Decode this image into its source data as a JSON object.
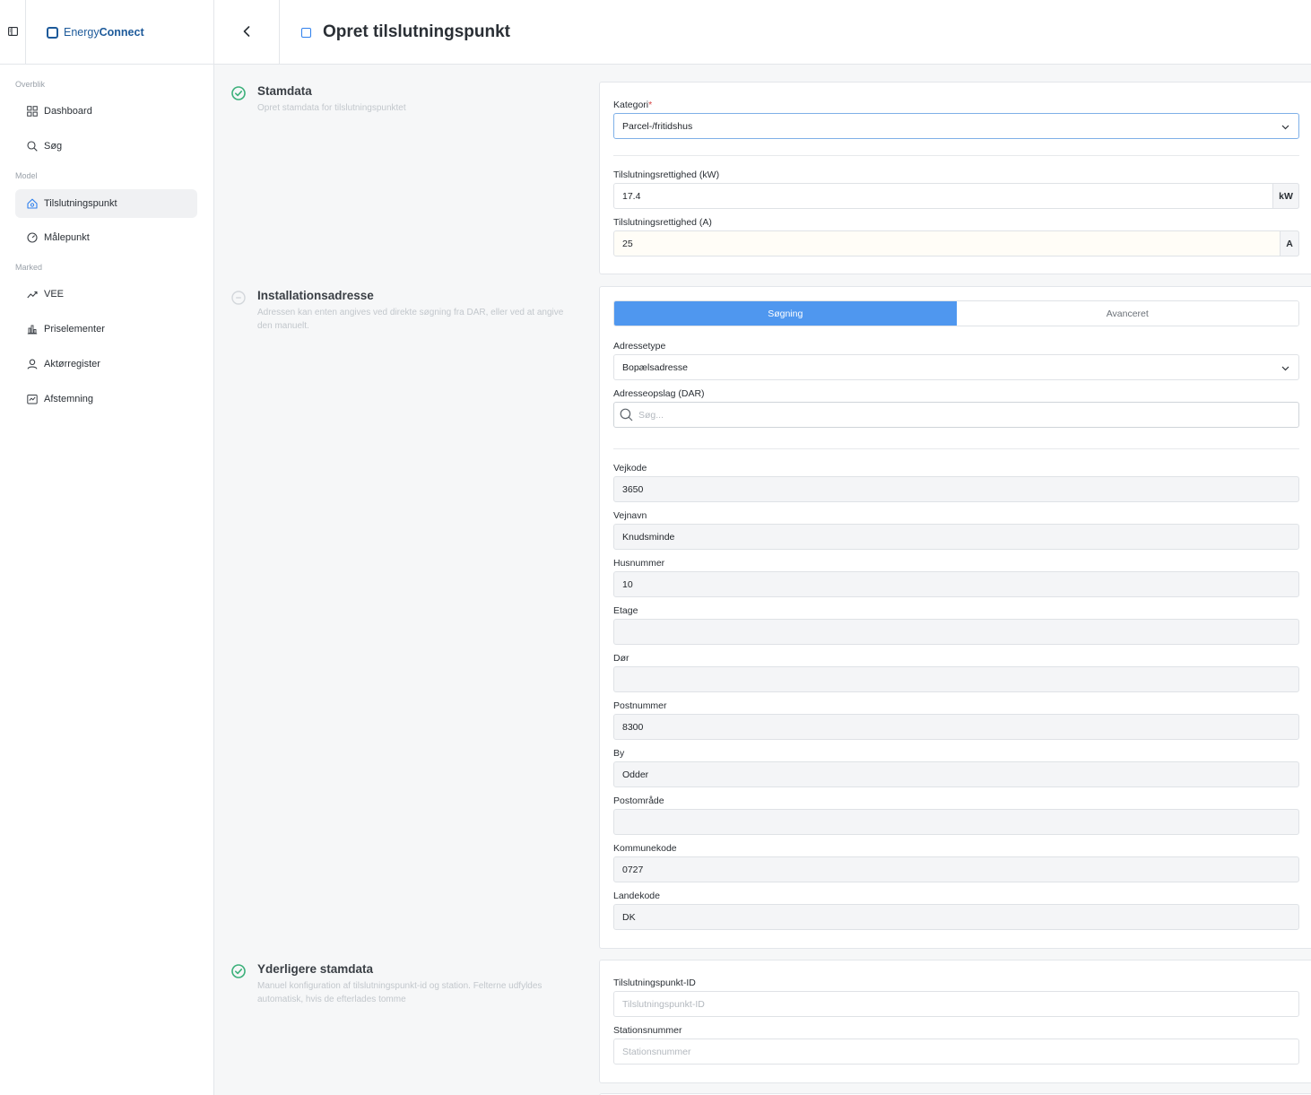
{
  "app": {
    "logo_part1": "Energy",
    "logo_part2": "Connect",
    "page_title": "Opret tilslutningspunkt"
  },
  "sidebar": {
    "sections": [
      {
        "label": "Overblik"
      },
      {
        "label": "Model"
      },
      {
        "label": "Marked"
      }
    ],
    "items": [
      {
        "label": "Dashboard",
        "icon": "dashboard-icon"
      },
      {
        "label": "Søg",
        "icon": "search-icon"
      },
      {
        "label": "Tilslutningspunkt",
        "icon": "connection-point-icon",
        "active": true
      },
      {
        "label": "Målepunkt",
        "icon": "meter-gauge-icon"
      },
      {
        "label": "VEE",
        "icon": "trend-icon"
      },
      {
        "label": "Priselementer",
        "icon": "price-chart-icon"
      },
      {
        "label": "Aktørregister",
        "icon": "user-icon"
      },
      {
        "label": "Afstemning",
        "icon": "reconciliation-icon"
      }
    ]
  },
  "steps": {
    "stamdata": {
      "title": "Stamdata",
      "desc": "Opret stamdata for tilslutningspunktet",
      "status": "complete"
    },
    "installationsadresse": {
      "title": "Installationsadresse",
      "desc": "Adressen kan enten angives ved direkte søgning fra DAR, eller ved at angive den manuelt.",
      "status": "pending"
    },
    "yderligere": {
      "title": "Yderligere stamdata",
      "desc": "Manuel konfiguration af tilslutningspunkt-id og station. Felterne udfyldes automatisk, hvis de efterlades tomme",
      "status": "complete"
    }
  },
  "stamdata_form": {
    "kategori_label": "Kategori",
    "kategori_required": "*",
    "kategori_value": "Parcel-/fritidshus",
    "kw_label": "Tilslutningsrettighed (kW)",
    "kw_value": "17.4",
    "kw_unit": "kW",
    "a_label": "Tilslutningsrettighed (A)",
    "a_value": "25",
    "a_unit": "A"
  },
  "address_form": {
    "tab_search": "Søgning",
    "tab_advanced": "Avanceret",
    "adressetype_label": "Adressetype",
    "adressetype_value": "Bopælsadresse",
    "opslag_label": "Adresseopslag (DAR)",
    "opslag_placeholder": "Søg...",
    "fields": [
      {
        "label": "Vejkode",
        "value": "3650"
      },
      {
        "label": "Vejnavn",
        "value": "Knudsminde"
      },
      {
        "label": "Husnummer",
        "value": "10"
      },
      {
        "label": "Etage",
        "value": ""
      },
      {
        "label": "Dør",
        "value": ""
      },
      {
        "label": "Postnummer",
        "value": "8300"
      },
      {
        "label": "By",
        "value": "Odder"
      },
      {
        "label": "Postområde",
        "value": ""
      },
      {
        "label": "Kommunekode",
        "value": "0727"
      },
      {
        "label": "Landekode",
        "value": "DK"
      }
    ]
  },
  "extra_form": {
    "id_label": "Tilslutningspunkt-ID",
    "id_placeholder": "Tilslutningspunkt-ID",
    "station_label": "Stationsnummer",
    "station_placeholder": "Stationsnummer"
  },
  "colors": {
    "accent": "#4f97ef",
    "brand": "#1d5a9a",
    "success": "#3bb07a"
  }
}
